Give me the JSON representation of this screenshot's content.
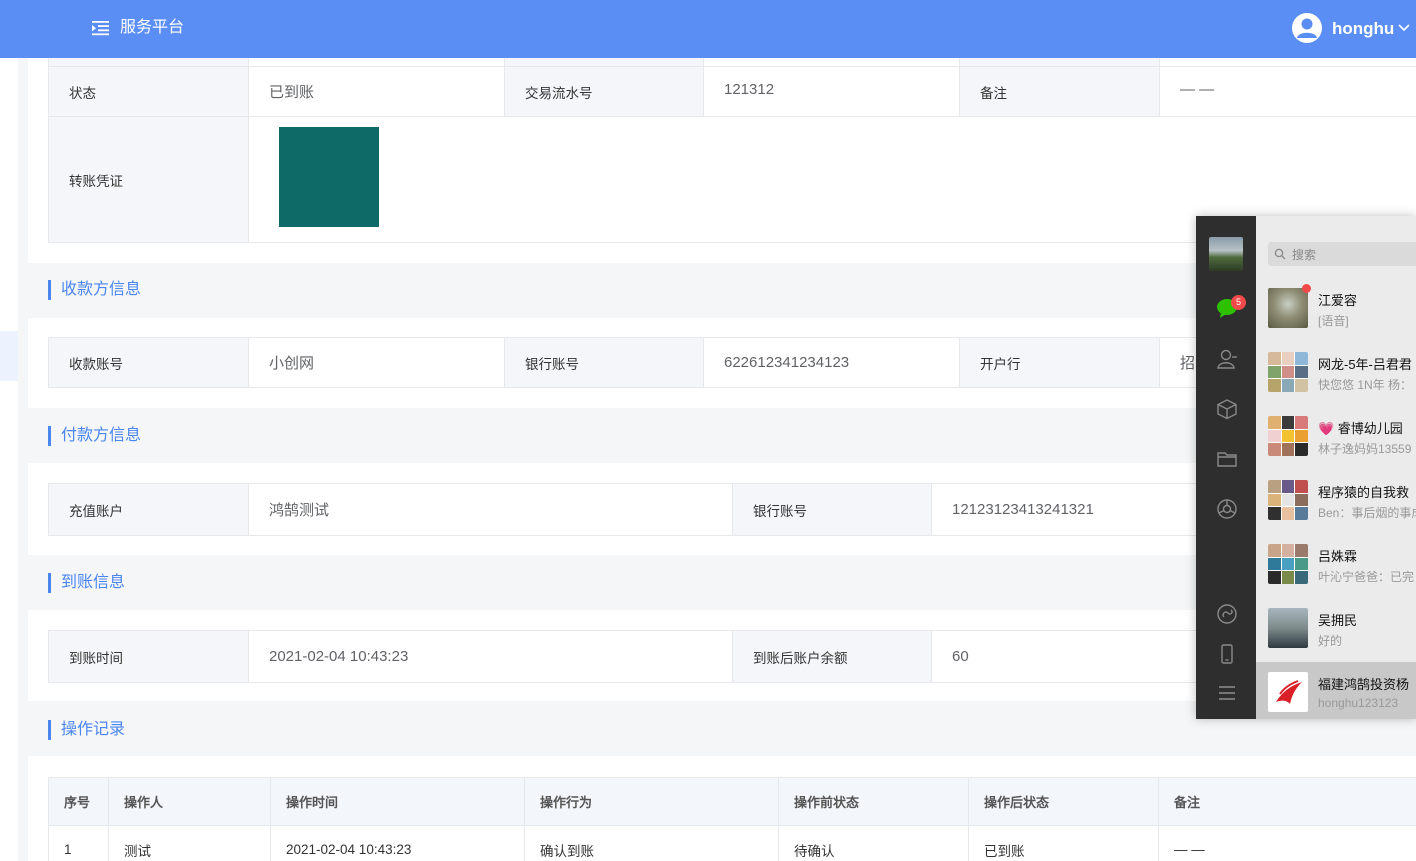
{
  "header": {
    "title": "服务平台",
    "username": "honghu"
  },
  "transfer": {
    "status_label": "状态",
    "status_value": "已到账",
    "serial_label": "交易流水号",
    "serial_value": "121312",
    "remark_label": "备注",
    "remark_value": "— —",
    "voucher_label": "转账凭证"
  },
  "payee": {
    "section_title": "收款方信息",
    "account_label": "收款账号",
    "account_value": "小创网",
    "bank_no_label": "银行账号",
    "bank_no_value": "622612341234123",
    "bank_label": "开户行",
    "bank_value": "招"
  },
  "payer": {
    "section_title": "付款方信息",
    "account_label": "充值账户",
    "account_value": "鸿鹄测试",
    "bank_no_label": "银行账号",
    "bank_no_value": "12123123413241321"
  },
  "arrival": {
    "section_title": "到账信息",
    "time_label": "到账时间",
    "time_value": "2021-02-04 10:43:23",
    "balance_label": "到账后账户余额",
    "balance_value": "60"
  },
  "operations": {
    "section_title": "操作记录",
    "columns": [
      "序号",
      "操作人",
      "操作时间",
      "操作行为",
      "操作前状态",
      "操作后状态",
      "备注"
    ],
    "rows": [
      [
        "1",
        "测试",
        "2021-02-04 10:43:23",
        "确认到账",
        "待确认",
        "已到账",
        "— —"
      ]
    ]
  },
  "chat": {
    "unread_count": "5",
    "search_placeholder": "搜索",
    "conversations": [
      {
        "name": "江爱容",
        "preview": "[语音]",
        "avatar_icon": "tree-photo"
      },
      {
        "name": "网龙-5年-吕君君",
        "preview": "快您悠 1N年 杨：",
        "avatar_icon": "group-grid"
      },
      {
        "name": "💗 睿博幼儿园",
        "preview": "林子逸妈妈13559",
        "avatar_icon": "group-grid"
      },
      {
        "name": "程序猿的自我救",
        "preview": "Ben：事后烟的事成",
        "avatar_icon": "group-grid"
      },
      {
        "name": "吕姝霖",
        "preview": "叶沁宁爸爸：已完",
        "avatar_icon": "group-grid"
      },
      {
        "name": "吴拥民",
        "preview": "好的",
        "avatar_icon": "person-photo"
      },
      {
        "name": "福建鸿鹄投资杨",
        "preview": "honghu123123",
        "avatar_icon": "bird-logo"
      }
    ]
  }
}
